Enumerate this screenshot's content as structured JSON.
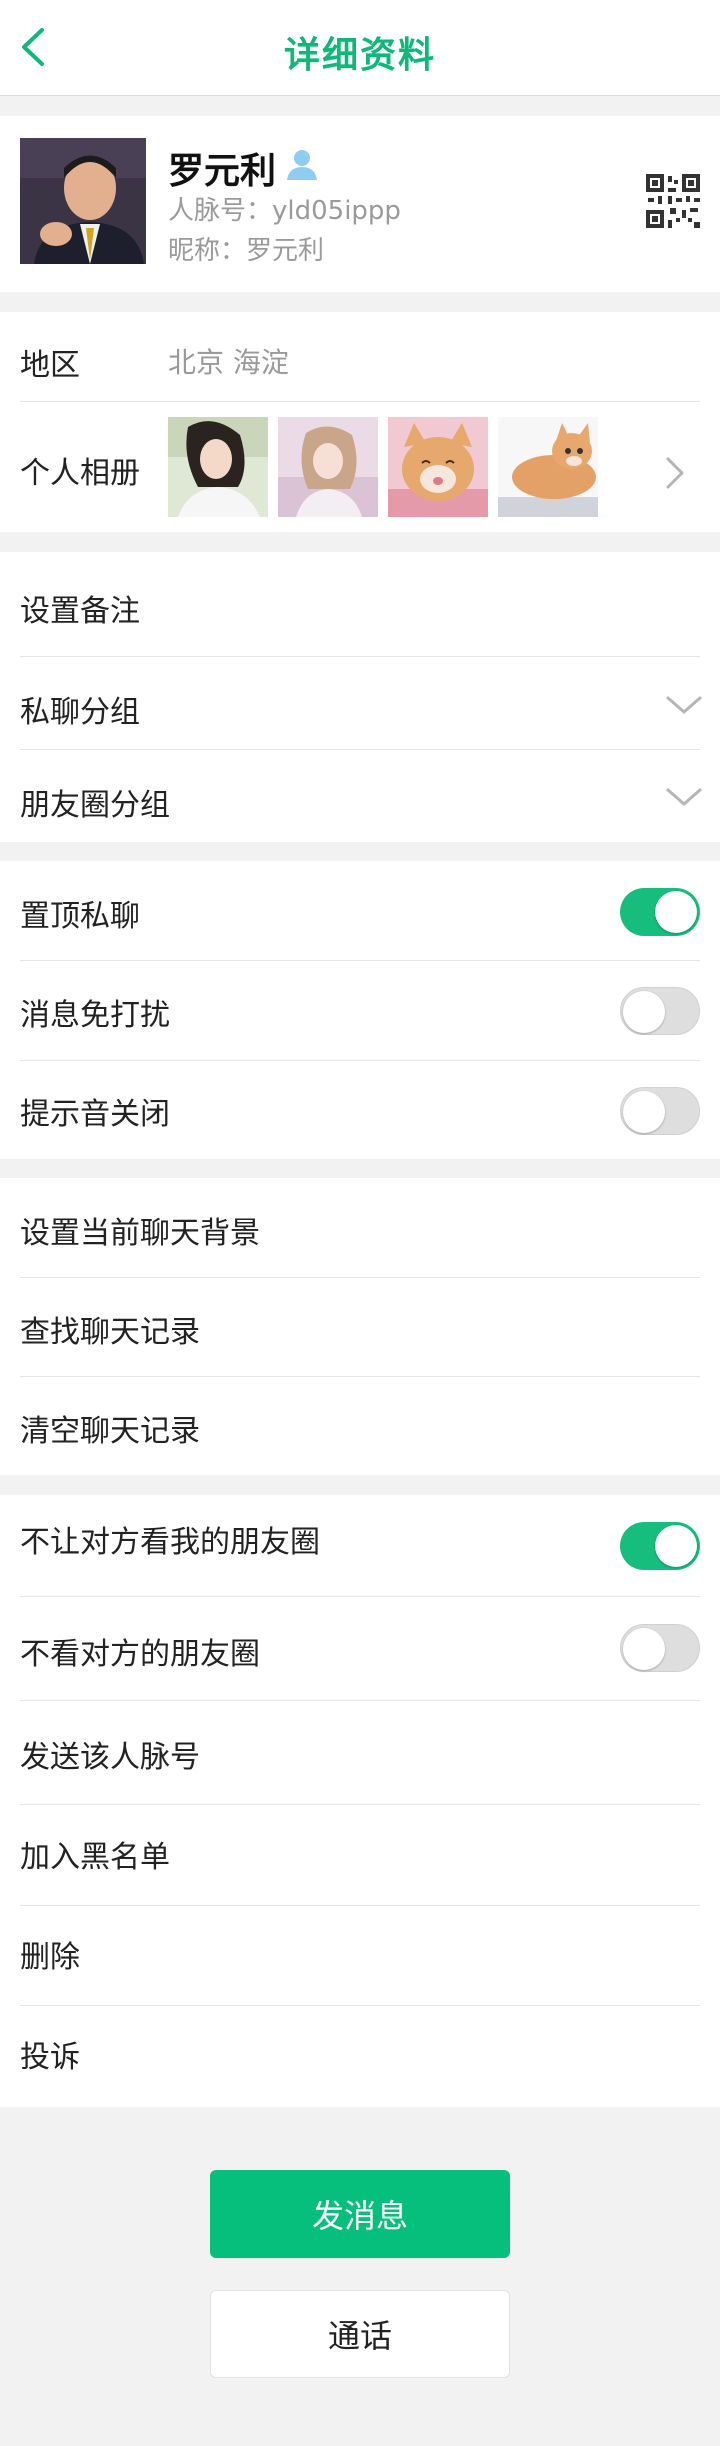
{
  "header": {
    "title": "详细资料"
  },
  "profile": {
    "name": "罗元利",
    "account_label": "人脉号：yld05ippp",
    "nickname_label": "昵称：罗元利"
  },
  "region": {
    "label": "地区",
    "value": "北京 海淀"
  },
  "album": {
    "label": "个人相册"
  },
  "settings1": {
    "remark": "设置备注",
    "private_group": "私聊分组",
    "moments_group": "朋友圈分组"
  },
  "settings2": {
    "pin_chat": {
      "label": "置顶私聊",
      "on": true
    },
    "mute": {
      "label": "消息免打扰",
      "on": false
    },
    "sound_off": {
      "label": "提示音关闭",
      "on": false
    }
  },
  "settings3": {
    "chat_bg": "设置当前聊天背景",
    "search_history": "查找聊天记录",
    "clear_history": "清空聊天记录"
  },
  "settings4": {
    "block_moments": {
      "label": "不让对方看我的朋友圈",
      "on": true
    },
    "hide_moments": {
      "label": "不看对方的朋友圈",
      "on": false
    },
    "send_card": "发送该人脉号",
    "blacklist": "加入黑名单",
    "delete": "删除",
    "report": "投诉"
  },
  "actions": {
    "send_message": "发消息",
    "call": "通话"
  },
  "colors": {
    "accent": "#0fb879",
    "button": "#07bf7c",
    "toggle_on": "#16bd7c"
  }
}
